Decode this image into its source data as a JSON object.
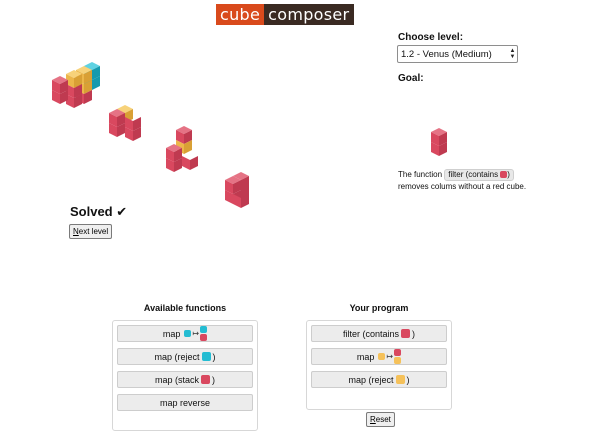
{
  "app": {
    "logo_part1": "cube",
    "logo_part2": "composer"
  },
  "colors": {
    "red": "#d9485f",
    "yellow": "#f5c15a",
    "cyan": "#24bcd2",
    "accent_logo": "#d94a1c",
    "logo_dark": "#3a2a22"
  },
  "level": {
    "heading": "Choose level:",
    "selected": "1.2 - Venus (Medium)"
  },
  "goal": {
    "heading": "Goal:",
    "description_before": "The function",
    "function_label": "filter (contains",
    "function_color": "red",
    "function_close": ")",
    "description_after": "removes colums without a red cube."
  },
  "status": {
    "solved_label": "Solved ✔",
    "next_button_underlined": "N",
    "next_button_rest": "ext level"
  },
  "available": {
    "title": "Available functions",
    "functions": [
      {
        "label": "map",
        "icon": "map-cyan-to-cyan-red-icon"
      },
      {
        "label": "map (reject",
        "color": "cyan",
        "close": ")"
      },
      {
        "label": "map (stack",
        "color": "red",
        "close": ")"
      },
      {
        "label": "map reverse"
      }
    ]
  },
  "program": {
    "title": "Your program",
    "functions": [
      {
        "label": "filter (contains",
        "color": "red",
        "close": ")"
      },
      {
        "label": "map",
        "icon": "map-yellow-to-yellow-red-icon"
      },
      {
        "label": "map (reject",
        "color": "yellow",
        "close": ")"
      }
    ],
    "reset_underlined": "R",
    "reset_rest": "eset"
  },
  "cube_columns": [
    [
      "red",
      "red"
    ],
    [
      "red",
      "red",
      "yellow"
    ],
    [
      "red",
      "yellow",
      "yellow"
    ],
    [
      "red",
      "cyan",
      "cyan"
    ],
    [
      "red",
      "red",
      "yellow"
    ],
    [
      "red",
      "red",
      "red",
      "yellow",
      "red"
    ],
    [
      "red",
      "red",
      "red",
      "red"
    ]
  ]
}
